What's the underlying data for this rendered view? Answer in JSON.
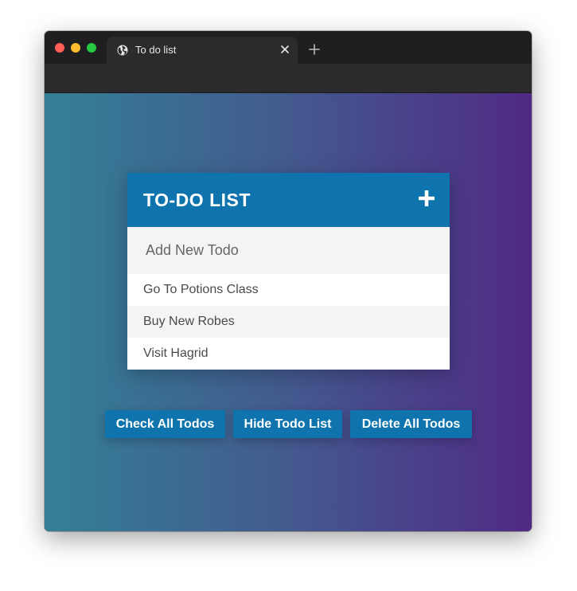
{
  "browser": {
    "tab_title": "To do list"
  },
  "todo": {
    "title": "TO-DO LIST",
    "input_placeholder": "Add New Todo",
    "items": [
      "Go To Potions Class",
      "Buy New Robes",
      "Visit Hagrid"
    ]
  },
  "actions": {
    "check_all": "Check All Todos",
    "hide_list": "Hide Todo List",
    "delete_all": "Delete All Todos"
  },
  "colors": {
    "accent": "#0f74ad",
    "gradient_start": "#347f96",
    "gradient_end": "#502a85"
  }
}
